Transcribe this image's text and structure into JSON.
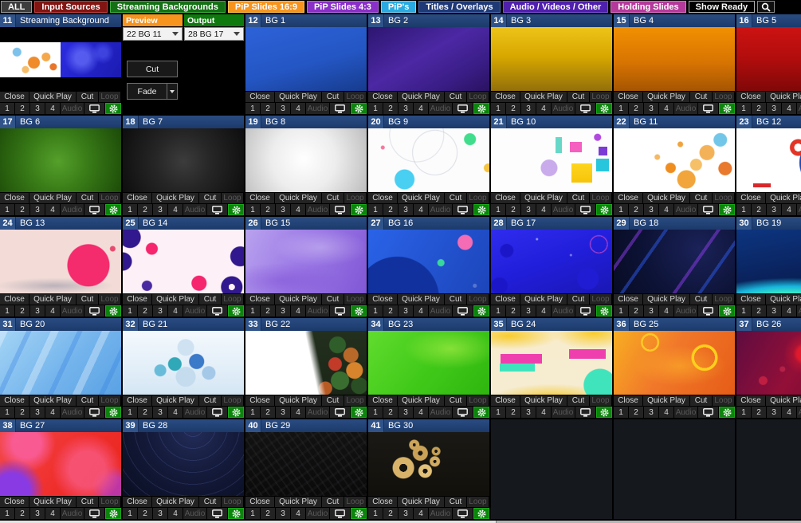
{
  "tabs": [
    {
      "label": "ALL",
      "style": "background:#3d3d3d;border:1px solid #9a9a9a"
    },
    {
      "label": "Input Sources",
      "style": "background:#811512;border:1px solid #c24040"
    },
    {
      "label": "Streaming Backgrounds",
      "style": "background:#157015;border:1px solid #3fae3f"
    },
    {
      "label": "PiP Slides 16:9",
      "style": "background:#f7941e;border:1px solid #ffc050"
    },
    {
      "label": "PiP Slides 4:3",
      "style": "background:#8a2fc8;border:1px solid #b66ae8"
    },
    {
      "label": "PiP's",
      "style": "background:#29abe2;border:1px solid #7fd2f5"
    },
    {
      "label": "Titles / Overlays",
      "style": "background:#1f3977;border:1px solid #4a6cb4"
    },
    {
      "label": "Audio / Videos / Other",
      "style": "background:#4f1fae;border:1px solid #7d4fd8"
    },
    {
      "label": "Holding Slides",
      "style": "background:#b5399b;border:1px solid #e272c8"
    },
    {
      "label": "Show Ready",
      "style": "background:#000000;border:1px solid #b0b0b0"
    }
  ],
  "icons": {
    "search": "magnifier",
    "monitor": "display-screen",
    "gear": "settings-gear",
    "select_chevron": "down-chevron",
    "fade_arrow": "down-triangle"
  },
  "colors": {
    "header_blue": "#1c3a6b",
    "number_chip_blue": "#30548a",
    "gear_green": "#0d850d",
    "preview_orange": "#f7941e",
    "output_green": "#0e7a0e"
  },
  "transition": {
    "preview_label": "Preview",
    "output_label": "Output",
    "preview_value": "22 BG 11",
    "output_value": "28 BG 17",
    "cut_label": "Cut",
    "fade_label": "Fade"
  },
  "tile_controls": {
    "close": "Close",
    "quick_play": "Quick Play",
    "cut": "Cut",
    "loop": "Loop",
    "inputs": [
      "1",
      "2",
      "3",
      "4"
    ],
    "audio": "Audio"
  },
  "mix_tile": {
    "number": "11",
    "name": "Streaming Background",
    "thumb_left": "background:radial-gradient(circle at 28% 28%,#7cc2ea 0 5px,transparent 6px),radial-gradient(circle at 56% 58%,#ef8b2b 0 7px,transparent 8px),radial-gradient(circle at 76% 42%,#f5a84b 0 5px,transparent 6px),radial-gradient(circle at 42% 78%,#f6bd6b 0 4px,transparent 5px),radial-gradient(circle at 88% 70%,#e8762a 0 4px,transparent 5px),#ffffff",
    "thumb_right": "background:radial-gradient(circle at 35% 45%,rgba(110,120,255,.65) 0 8px,transparent 22px),radial-gradient(circle at 70% 30%,rgba(90,100,250,.5) 0 5px,transparent 14px),linear-gradient(120deg,#2c2ce2 0%,#1b1bb0 100%)"
  },
  "tiles": [
    {
      "number": "12",
      "name": "BG 1",
      "thumb": "background:linear-gradient(165deg,#2d62d8 0%,#2456c4 55%,#173c8e 100%)"
    },
    {
      "number": "13",
      "name": "BG 2",
      "thumb": "background:linear-gradient(150deg,#2c1670 0%,#4c28a4 45%,#3a1d86 75%,#2a1260 100%)"
    },
    {
      "number": "14",
      "name": "BG 3",
      "thumb": "background:linear-gradient(180deg,#eec419 0%,#d8a800 45%,#93700a 100%)"
    },
    {
      "number": "15",
      "name": "BG 4",
      "thumb": "background:linear-gradient(180deg,#f29002 0%,#d87402 55%,#a55502 100%)"
    },
    {
      "number": "16",
      "name": "BG 5",
      "thumb": "background:linear-gradient(180deg,#cd1212 0%,#b10d0d 50%,#800808 100%)"
    },
    {
      "number": "17",
      "name": "BG 6",
      "thumb": "background:radial-gradient(circle at 48% 52%,#55a02b 0%,#3a7d18 40%,#1c4a08 100%)"
    },
    {
      "number": "18",
      "name": "BG 7",
      "thumb": "background:radial-gradient(circle at 50% 52%,#3c3c3c 0%,#262626 40%,#0d0d0d 100%)"
    },
    {
      "number": "19",
      "name": "BG 8",
      "thumb": "background:radial-gradient(circle at 48% 48%,#ffffff 0%,#ededed 45%,#bdbdbd 100%)"
    },
    {
      "number": "20",
      "name": "BG 9",
      "thumb": "background:radial-gradient(circle at 84% 17%,#41dd8d 0 7px,transparent 8px),radial-gradient(circle at 30% 80%,#49cff2 0 12px,transparent 13px),radial-gradient(circle at 99% 62%,#f6c43e 0 5px,transparent 6px),radial-gradient(circle at 12% 30%,#f4799e 0 2px,transparent 3px),radial-gradient(circle at 55% 38%,transparent 27px,rgba(165,175,190,.4) 28px,transparent 29px),radial-gradient(circle at 40% 10%,transparent 33px,rgba(165,175,190,.35) 34px,transparent 35px),#fcfcfd"
    },
    {
      "number": "21",
      "name": "BG 10",
      "thumb": "background:linear-gradient(#f55fc0,#f55fc0) 72% 26%/15px 13px no-repeat,linear-gradient(#ffd51e,#f6c50a) 80% 78%/26px 24px no-repeat,linear-gradient(#27c6dd,#27c6dd) 97% 60%/16px 16px no-repeat,linear-gradient(#7b3bd4,#7b3bd4) 96% 34%/11px 11px no-repeat,linear-gradient(#67d8c8,#67d8c8) 56% 18%/8px 20px no-repeat,radial-gradient(circle at 48% 62%,rgba(150,90,220,.5) 0 10px,transparent 11px),radial-gradient(circle at 88% 14%,#b049e0 0 4px,transparent 5px),#fdfdfd"
    },
    {
      "number": "22",
      "name": "BG 11",
      "thumb": "background:radial-gradient(circle at 60% 80%,#f2a53a 0 11px,transparent 12px),radial-gradient(circle at 77% 38%,#f4b258 0 9px,transparent 10px),radial-gradient(circle at 88% 18%,#72c6e8 0 8px,transparent 9px),radial-gradient(circle at 47% 62%,#ef8d20 0 6px,transparent 7px),radial-gradient(circle at 68% 57%,#f6c068 0 7px,transparent 8px),radial-gradient(circle at 92% 63%,#e8792d 0 8px,transparent 9px),radial-gradient(circle at 36% 45%,#f5b863 0 3px,transparent 4px),radial-gradient(circle at 55% 25%,#f2a33c 0 3px,transparent 4px),#ffffff"
    },
    {
      "number": "23",
      "name": "BG 12",
      "thumb": "background:radial-gradient(circle at 51% 30%,transparent 0 5px,#e23527 5px 10px,transparent 11px),radial-gradient(circle at 74% 54%,#1d49bb 0 33px,transparent 34px),radial-gradient(circle at 94% 13%,#2a52c0 0 2px,transparent 3px),radial-gradient(circle at 88% 13%,#2a52c0 0 2px,transparent 3px),radial-gradient(circle at 82% 13%,#2a52c0 0 2px,transparent 3px),linear-gradient(#e23527,#e23527) 96% 45%/10px 22px no-repeat,linear-gradient(#d8272a,#d8272a) 16% 92%/22px 5px no-repeat,linear-gradient(#1a3a9a,#1a3a9a) 88% 93%/26px 4px no-repeat,linear-gradient(90deg,#ffffff 62%,#fcecea)"
    },
    {
      "number": "24",
      "name": "BG 13",
      "thumb": "background:radial-gradient(circle at 73% 56%,#f42b6d 0 26px,transparent 27px),radial-gradient(circle at 93% 30%,#e84a6e 0 3px,transparent 4px),radial-gradient(ellipse 70% 18% at 45% 88%,rgba(45,70,110,.28),transparent 70%),#f3dcd7"
    },
    {
      "number": "25",
      "name": "BG 14",
      "thumb": "background:radial-gradient(circle at 6% 12%,#31188e 0 13px,transparent 14px),radial-gradient(circle at 0% 50%,#31188e 0 11px,transparent 12px),radial-gradient(circle at 97% 42%,#31188e 0 12px,transparent 13px),radial-gradient(circle at 90% 90%,transparent 0 4px,#31188e 4px 13px,transparent 14px),radial-gradient(circle at 24% 30%,#f5256e 0 7px,transparent 8px),radial-gradient(circle at 63% 84%,#f5256e 0 9px,transparent 10px),radial-gradient(circle at 20% 88%,#4a2aa0 0 6px,transparent 7px),#fdf0f6"
    },
    {
      "number": "26",
      "name": "BG 15",
      "thumb": "background:radial-gradient(ellipse 60% 45% at 62% 28%,rgba(255,255,255,.30),transparent 65%),radial-gradient(ellipse 70% 40% at 30% 80%,rgba(120,70,210,.45),transparent 70%),linear-gradient(115deg,#b9a2ee 0%,#9c7ae6 45%,#8157d6 100%)"
    },
    {
      "number": "27",
      "name": "BG 16",
      "thumb": "background:radial-gradient(circle at 80% 20%,#f46cb4 0 9px,transparent 10px),radial-gradient(circle at 60% 52%,#38d89c 0 4px,transparent 5px),radial-gradient(circle at 24% 108%,#11329e 0 52px,transparent 53px),radial-gradient(circle at 88% 88%,rgba(255,255,255,.25) 0 2px,transparent 3px),linear-gradient(120deg,#2a63e8 0%,#1c45ba 100%)"
    },
    {
      "number": "28",
      "name": "BG 17",
      "thumb": "background:radial-gradient(circle at 13% 33%,#1b17c9 0 8px,transparent 9px),radial-gradient(circle at 7% 88%,#1b17c9 0 10px,transparent 11px),radial-gradient(circle at 80% 77%,#201cd4 0 13px,transparent 14px),radial-gradient(circle at 89% 23%,transparent 0 10px,rgba(242,82,196,.55) 10px 11px,transparent 12px),radial-gradient(circle at 38% 15%,rgba(255,255,255,.5) 0 1px,transparent 2px),radial-gradient(circle at 66% 40%,rgba(255,255,255,.4) 0 1px,transparent 2px),linear-gradient(160deg,#2f2cee 0%,#211eda 50%,#1a17b4 100%)"
    },
    {
      "number": "29",
      "name": "BG 18",
      "thumb": "background:repeating-linear-gradient(125deg,transparent 0 26px,rgba(140,60,235,.5) 26px 30px,transparent 30px 52px,rgba(45,90,235,.5) 52px 56px,transparent 56px 80px),radial-gradient(circle at 70% 30%,#1a2258 0%,#0c1234 60%,#080c24 100%)"
    },
    {
      "number": "30",
      "name": "BG 19",
      "thumb": "background:radial-gradient(ellipse 130% 75% at 45% 125%,#3df2c2 0 32%,#18b4dc 48%,rgba(10,50,130,0) 66%),radial-gradient(circle at 80% 15%,rgba(255,255,255,.5) 0 1px,transparent 2px),linear-gradient(170deg,#0d3580 0%,#0a2460 55%,#071a48 100%)"
    },
    {
      "number": "31",
      "name": "BG 20",
      "thumb": "background:repeating-linear-gradient(115deg,rgba(255,255,255,.32) 0 9px,rgba(255,255,255,0) 9px 30px,rgba(50,125,225,.32) 30px 36px,rgba(50,125,225,0) 36px 58px),linear-gradient(135deg,#a3d4f5 0%,#74b4ec 55%,#5aa2e4 100%)"
    },
    {
      "number": "32",
      "name": "BG 21",
      "thumb": "background:radial-gradient(circle at 52% 26%,#cfe2f2 0 10px,transparent 11px),radial-gradient(circle at 43% 52%,#31a8b8 0 8px,transparent 9px),radial-gradient(circle at 61% 48%,#3b79c9 0 9px,transparent 10px),radial-gradient(circle at 31% 62%,#68bcd9 0 7px,transparent 8px),radial-gradient(circle at 71% 66%,#a4c8e8 0 8px,transparent 9px),radial-gradient(circle at 52% 72%,#c4dcee 0 12px,transparent 13px),linear-gradient(180deg,#f4f9fd 0%,#e2eef8 60%,#d4e6f4 100%)"
    },
    {
      "number": "33",
      "name": "BG 22",
      "thumb": "background:linear-gradient(78deg,#ffffff 0 54%,rgba(255,255,255,0) 60%),radial-gradient(circle at 76% 22%,#2f5e2a 0 10px,transparent 11px),radial-gradient(circle at 87% 38%,#b8692a 0 9px,transparent 10px),radial-gradient(circle at 74% 52%,#c23a28 0 8px,transparent 9px),radial-gradient(circle at 90% 62%,#d8842c 0 10px,transparent 11px),radial-gradient(circle at 78% 78%,#3a6e30 0 11px,transparent 12px),radial-gradient(circle at 94% 86%,#2a4f24 0 10px,transparent 11px),radial-gradient(circle at 66% 90%,#b85a24 0 8px,transparent 9px),linear-gradient(180deg,#24301e 0%,#1a2517 100%)"
    },
    {
      "number": "34",
      "name": "BG 23",
      "thumb": "background:radial-gradient(ellipse 55% 45% at 68% 28%,rgba(190,245,80,.55),transparent 70%),linear-gradient(130deg,#61dc2e 0%,#42ca1a 50%,#2eb60f 100%)"
    },
    {
      "number": "35",
      "name": "BG 24",
      "thumb": "background:linear-gradient(#ef3fae,#ef3fae) 12% 42%/52px 12px no-repeat,linear-gradient(#40e4bc,#40e4bc) 10% 58%/44px 10px no-repeat,linear-gradient(#ef3fae,#ef3fae) 92% 34%/46px 12px no-repeat,radial-gradient(circle at 90% 85%,#40e4bc 0 20px,transparent 21px),radial-gradient(ellipse 60% 30% at 15% 8%,#f8cc2e,transparent 70%),radial-gradient(ellipse 50% 35% at 85% 4%,#f8cc2e,transparent 70%),radial-gradient(ellipse 70% 35% at 50% 108%,#f6c822,transparent 72%),linear-gradient(180deg,#f8eccc 0%,#f5ecd2 100%)"
    },
    {
      "number": "36",
      "name": "BG 25",
      "thumb": "background:radial-gradient(circle at 75% 42%,transparent 0 13px,#ffd01c 13px 16px,transparent 17px),radial-gradient(circle at 30% 18%,transparent 0 9px,#ffc928 9px 11px,transparent 12px),radial-gradient(ellipse 55% 45% at 55% 55%,rgba(255,190,40,.5),transparent 70%),linear-gradient(120deg,#f8ae22 0%,#f1782a 45%,#e65c17 100%)"
    },
    {
      "number": "37",
      "name": "BG 26",
      "thumb": "background:radial-gradient(circle at 56% 36%,#e01a2c 0 9px,rgba(224,26,44,.35) 14px,transparent 26px),radial-gradient(circle at 88% 72%,#d81848 0 7px,transparent 8px),radial-gradient(circle at 22% 78%,rgba(230,40,70,.6) 0 5px,transparent 6px),radial-gradient(circle at 76% 18%,rgba(240,150,60,.5) 0 2px,transparent 3px),radial-gradient(circle at 38% 60%,rgba(240,60,90,.4) 0 3px,transparent 4px),linear-gradient(120deg,#5f0c40 0%,#930f38 50%,#6b0830 100%)"
    },
    {
      "number": "38",
      "name": "BG 27",
      "thumb": "background:radial-gradient(circle at 10% 92%,#8a3ae2 0 22px,transparent 40px),radial-gradient(circle at 22% 18%,rgba(250,95,160,.85) 0 18px,transparent 36px),radial-gradient(circle at 72% 58%,rgba(248,90,130,.8) 0 22px,transparent 44px),radial-gradient(circle at 94% 88%,rgba(170,60,220,.7) 0 14px,transparent 28px),linear-gradient(125deg,#f2484a 0%,#ef2f2c 55%,#e8251e 100%)"
    },
    {
      "number": "39",
      "name": "BG 28",
      "thumb": "background:repeating-radial-gradient(circle at 58% -10%,transparent 0 13px,rgba(130,160,255,.14) 13px 14px,transparent 14px 15px),radial-gradient(circle at 58% 0%,#222c58 0%,#141a3a 45%,#0a0e22 100%)"
    },
    {
      "number": "40",
      "name": "BG 29",
      "thumb": "background:repeating-linear-gradient(55deg,rgba(70,70,75,.18) 0 2px,rgba(0,0,0,0) 2px 8px),repeating-linear-gradient(-35deg,rgba(40,40,45,.25) 0 3px,rgba(0,0,0,0) 3px 11px),linear-gradient(180deg,#121212 0%,#0a0a0a 100%)"
    },
    {
      "number": "41",
      "name": "BG 30",
      "thumb": "background:radial-gradient(circle at 29% 56%,transparent 0 5px,#d9b369 5px 13px,transparent 14px),radial-gradient(circle at 43% 33%,transparent 0 3px,#c9a257 3px 9px,transparent 10px),radial-gradient(circle at 47% 61%,transparent 0 3px,#e2c179 3px 8px,transparent 9px),radial-gradient(circle at 55% 46%,transparent 0 2px,#d2ab61 2px 6px,transparent 7px),radial-gradient(circle at 38% 20%,transparent 0 2px,#cba55b 2px 6px,transparent 7px),radial-gradient(circle at 56% 30%,transparent 0 2px,#c49e54 2px 5px,transparent 6px),linear-gradient(180deg,#1b1915 0%,#11100b 100%)"
    }
  ]
}
